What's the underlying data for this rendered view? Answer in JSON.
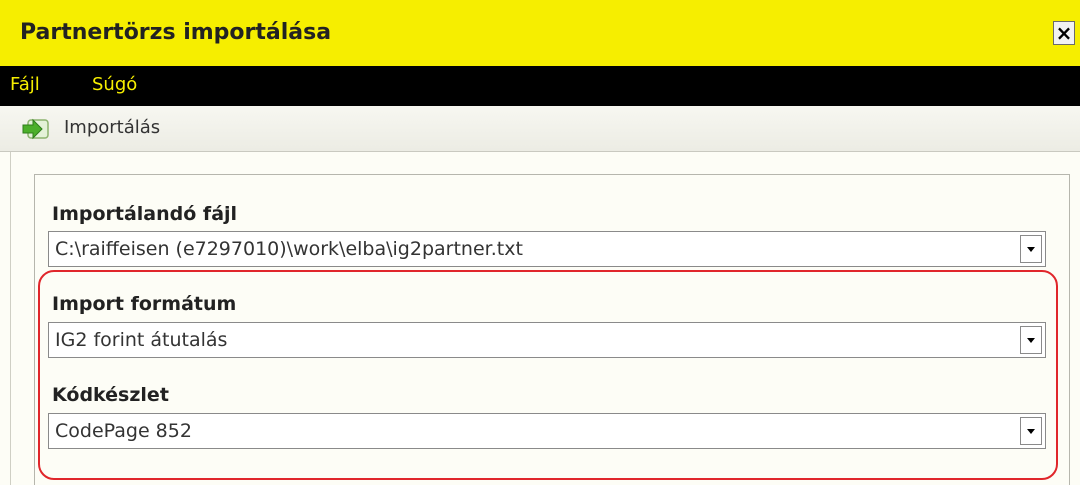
{
  "window": {
    "title": "Partnertörzs importálása",
    "close_label": "×"
  },
  "menu": {
    "items": [
      "Fájl",
      "Súgó"
    ]
  },
  "toolbar": {
    "import_label": "Importálás",
    "import_icon": "import-arrow-icon"
  },
  "form": {
    "file": {
      "label": "Importálandó fájl",
      "value": "C:\\raiffeisen (e7297010)\\work\\elba\\ig2partner.txt"
    },
    "format": {
      "label": "Import formátum",
      "value": "IG2 forint átutalás"
    },
    "codepage": {
      "label": "Kódkészlet",
      "value": "CodePage 852"
    }
  },
  "colors": {
    "titlebar": "#f6ee00",
    "menubar": "#000000",
    "menu_text": "#f6ee00",
    "highlight": "#e0262b"
  }
}
